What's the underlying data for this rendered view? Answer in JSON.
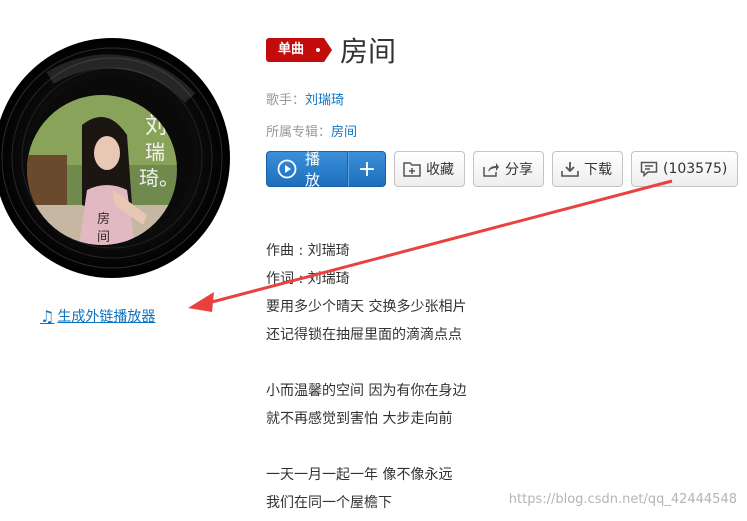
{
  "song": {
    "badge": "单曲",
    "title": "房间",
    "singer_label": "歌手：",
    "singer": "刘瑞琦",
    "album_label": "所属专辑：",
    "album": "房间"
  },
  "actions": {
    "play": "播放",
    "add": "+",
    "collect": "收藏",
    "share": "分享",
    "download": "下载",
    "comment_count": "(103575)"
  },
  "player_link": "生成外链播放器",
  "cover": {
    "text_a": "刘",
    "text_b": "瑞",
    "text_c": "琦。",
    "text_d": "房",
    "text_e": "间"
  },
  "lyrics": [
    "作曲 : 刘瑞琦",
    "作词 : 刘瑞琦",
    "要用多少个晴天 交换多少张相片",
    "还记得锁在抽屉里面的滴滴点点",
    "",
    "小而温馨的空间 因为有你在身边",
    "就不再感觉到害怕 大步走向前",
    "",
    "一天一月一起一年 像不像永远",
    "我们在同一个屋檐下"
  ],
  "watermark": "https://blog.csdn.net/qq_42444548",
  "colors": {
    "badge": "#c20c0c",
    "link": "#0c73c2",
    "play_button": "#2a7ccd",
    "arrow": "#e8413e"
  }
}
